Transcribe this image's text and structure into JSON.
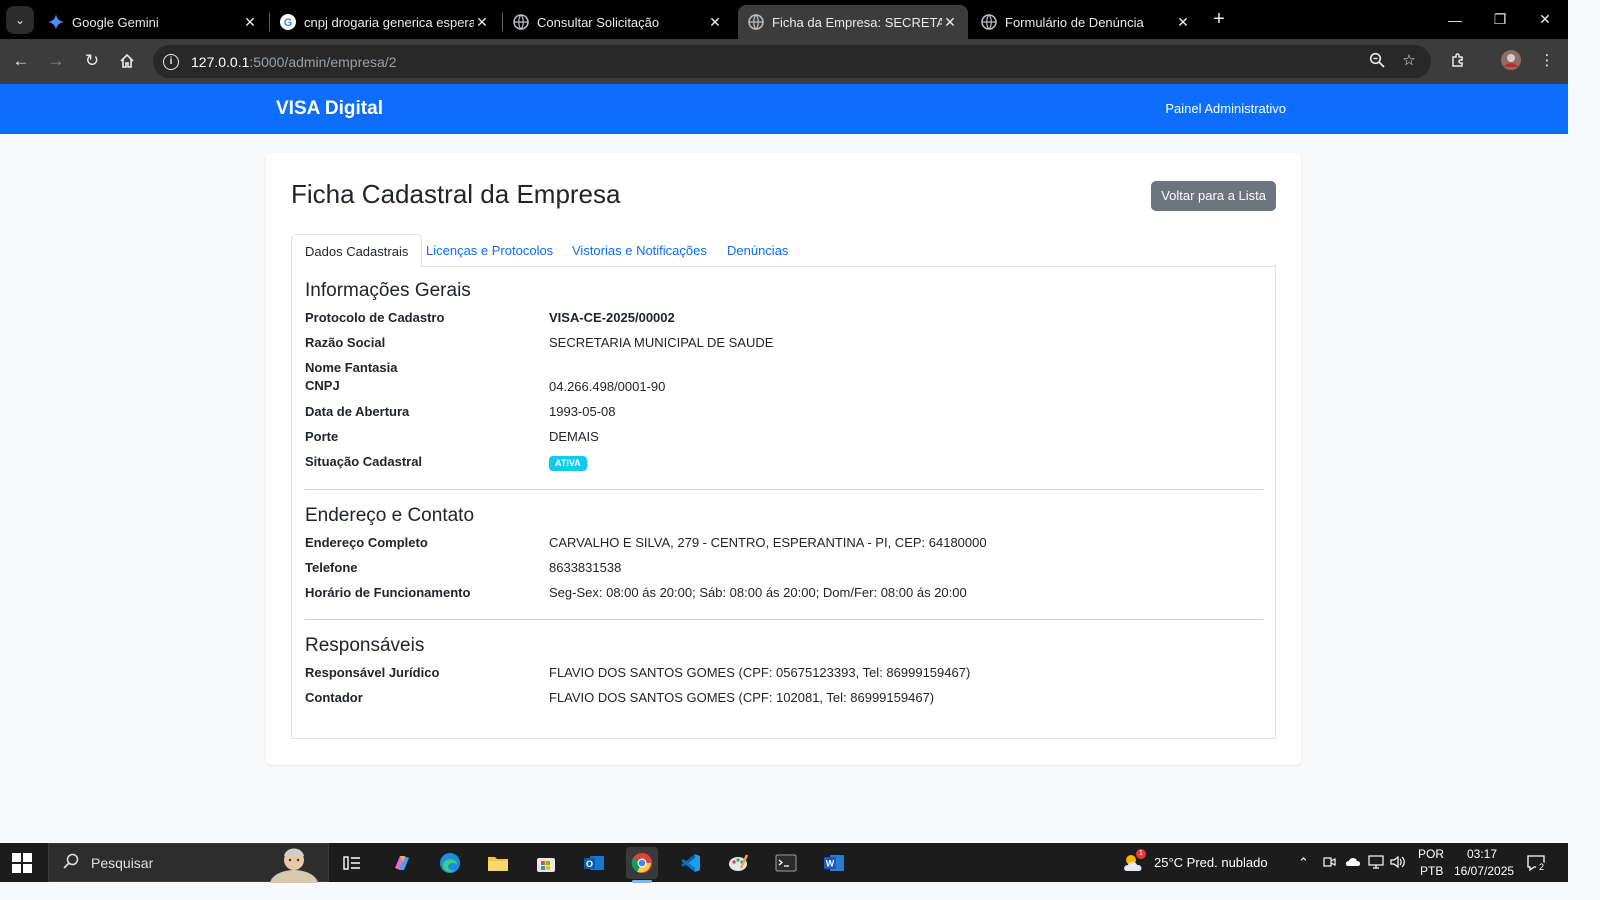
{
  "browser": {
    "tabs": [
      {
        "title": "Google Gemini",
        "icon": "gemini-icon"
      },
      {
        "title": "cnpj drogaria generica esperantina",
        "icon": "google-icon"
      },
      {
        "title": "Consultar Solicitação",
        "icon": "globe-icon"
      },
      {
        "title": "Ficha da Empresa: SECRETARIA MUNICIPAL",
        "icon": "globe-icon",
        "active": true
      },
      {
        "title": "Formulário de Denúncia",
        "icon": "globe-icon"
      }
    ],
    "url_host": "127.0.0.1",
    "url_rest": ":5000/admin/empresa/2"
  },
  "app": {
    "brand": "VISA Digital",
    "nav_link": "Painel Administrativo",
    "primary_color": "#0d6efd"
  },
  "page": {
    "title": "Ficha Cadastral da Empresa",
    "back_button": "Voltar para a Lista",
    "tabs": [
      "Dados Cadastrais",
      "Licenças e Protocolos",
      "Vistorias e Notificações",
      "Denúncias"
    ]
  },
  "sections": {
    "general": {
      "title": "Informações Gerais",
      "fields": [
        {
          "label": "Protocolo de Cadastro",
          "value": "VISA-CE-2025/00002"
        },
        {
          "label": "Razão Social",
          "value": "SECRETARIA MUNICIPAL DE SAUDE"
        },
        {
          "label": "Nome Fantasia",
          "value": ""
        },
        {
          "label": "CNPJ",
          "value": "04.266.498/0001-90"
        },
        {
          "label": "Data de Abertura",
          "value": "1993-05-08"
        },
        {
          "label": "Porte",
          "value": "DEMAIS"
        },
        {
          "label": "Situação Cadastral",
          "value": "ATIVA"
        }
      ]
    },
    "address": {
      "title": "Endereço e Contato",
      "fields": [
        {
          "label": "Endereço Completo",
          "value": "CARVALHO E SILVA, 279 - CENTRO, ESPERANTINA - PI, CEP: 64180000"
        },
        {
          "label": "Telefone",
          "value": "8633831538"
        },
        {
          "label": "Horário de Funcionamento",
          "value": "Seg-Sex: 08:00 ás 20:00; Sáb: 08:00 ás 20:00; Dom/Fer: 08:00 ás 20:00"
        }
      ]
    },
    "responsibles": {
      "title": "Responsáveis",
      "fields": [
        {
          "label": "Responsável Jurídico",
          "value": "FLAVIO DOS SANTOS GOMES (CPF: 05675123393, Tel: 86999159467)"
        },
        {
          "label": "Contador",
          "value": "FLAVIO DOS SANTOS GOMES (CPF: 102081, Tel: 86999159467)"
        }
      ]
    }
  },
  "taskbar": {
    "search_placeholder": "Pesquisar",
    "weather": "25°C  Pred. nublado",
    "weather_badge": "1",
    "lang_top": "POR",
    "lang_bottom": "PTB",
    "time": "03:17",
    "date": "16/07/2025",
    "notifications": "2"
  }
}
